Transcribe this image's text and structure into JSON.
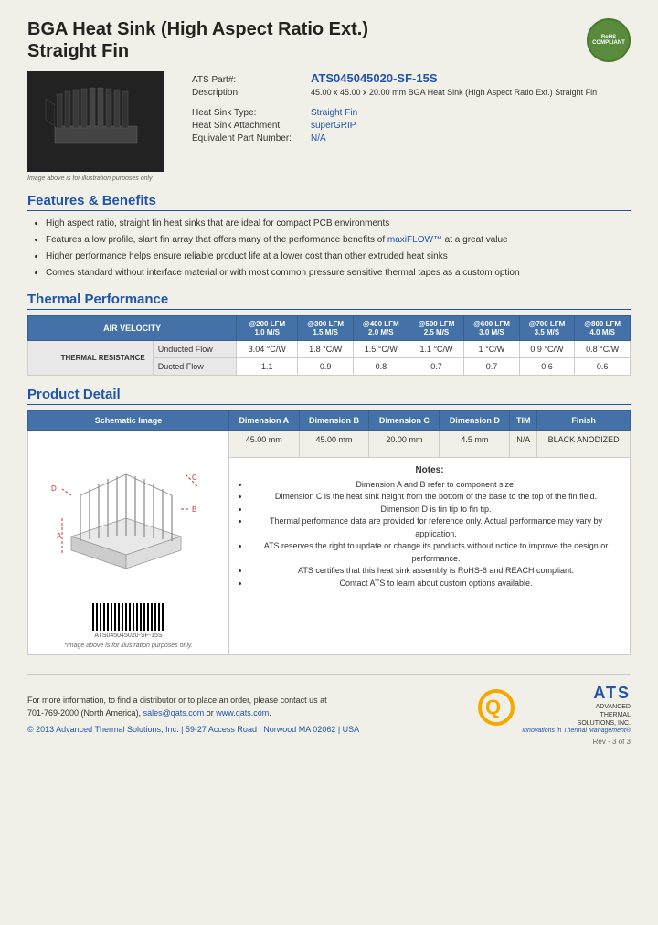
{
  "product": {
    "title_line1": "BGA Heat Sink (High Aspect Ratio Ext.)",
    "title_line2": "Straight Fin",
    "rohs": "RoHS\nCOMPLIANT",
    "part_label": "ATS Part#:",
    "part_number": "ATS045045020-SF-15S",
    "description_label": "Description:",
    "description": "45.00 x 45.00 x 20.00 mm BGA Heat Sink (High Aspect Ratio Ext.) Straight Fin",
    "heat_sink_type_label": "Heat Sink Type:",
    "heat_sink_type": "Straight Fin",
    "attachment_label": "Heat Sink Attachment:",
    "attachment": "superGRIP",
    "equiv_part_label": "Equivalent Part Number:",
    "equiv_part": "N/A",
    "image_note": "Image above is for illustration purposes only"
  },
  "features": {
    "title": "Features & Benefits",
    "items": [
      "High aspect ratio, straight fin heat sinks that are ideal for compact PCB environments",
      "Features a low profile, slant fin array that offers many of the performance benefits of maxiFLOW™ at a great value",
      "Higher performance helps ensure reliable product life at a lower cost than other extruded heat sinks",
      "Comes standard without interface material or with most common pressure sensitive thermal tapes as a custom option"
    ]
  },
  "thermal": {
    "title": "Thermal Performance",
    "headers": {
      "air_velocity": "AIR VELOCITY",
      "col1": "@200 LFM\n1.0 M/S",
      "col2": "@300 LFM\n1.5 M/S",
      "col3": "@400 LFM\n2.0 M/S",
      "col4": "@500 LFM\n2.5 M/S",
      "col5": "@600 LFM\n3.0 M/S",
      "col6": "@700 LFM\n3.5 M/S",
      "col7": "@800 LFM\n4.0 M/S"
    },
    "row_group": "THERMAL RESISTANCE",
    "rows": [
      {
        "label": "Unducted Flow",
        "values": [
          "3.04 °C/W",
          "1.8 °C/W",
          "1.5 °C/W",
          "1.1 °C/W",
          "1 °C/W",
          "0.9 °C/W",
          "0.8 °C/W"
        ]
      },
      {
        "label": "Ducted Flow",
        "values": [
          "1.1",
          "0.9",
          "0.8",
          "0.7",
          "0.7",
          "0.6",
          "0.6"
        ]
      }
    ]
  },
  "product_detail": {
    "title": "Product Detail",
    "table_headers": [
      "Schematic Image",
      "Dimension A",
      "Dimension B",
      "Dimension C",
      "Dimension D",
      "TIM",
      "Finish"
    ],
    "dimensions": {
      "A": "45.00 mm",
      "B": "45.00 mm",
      "C": "20.00 mm",
      "D": "4.5 mm",
      "TIM": "N/A",
      "Finish": "BLACK ANODIZED"
    },
    "image_note": "*Image above is for illustration purposes only.",
    "notes_title": "Notes:",
    "notes": [
      "Dimension A and B refer to component size.",
      "Dimension C is the heat sink height from the bottom of the base to the top of the fin field.",
      "Dimension D is fin tip to fin tip.",
      "Thermal performance data are provided for reference only. Actual performance may vary by application.",
      "ATS reserves the right to update or change its products without notice to improve the design or performance.",
      "ATS certifies that this heat sink assembly is RoHS-6 and REACH compliant.",
      "Contact ATS to learn about custom options available."
    ]
  },
  "footer": {
    "contact_text": "For more information, to find a distributor or to place an order, please contact us at\n701-769-2000 (North America),",
    "email": "sales@qats.com",
    "or_text": " or ",
    "website": "www.qats.com",
    "copyright": "© 2013 Advanced Thermal Solutions, Inc. | 59-27 Access Road | Norwood MA  02062 | USA",
    "ats_name": "ATS",
    "ats_full": "ADVANCED\nTHERMAL\nSOLUTIONS, INC.",
    "ats_tagline": "Innovations in Thermal Management®",
    "page_num": "Rev - 3 of 3"
  }
}
